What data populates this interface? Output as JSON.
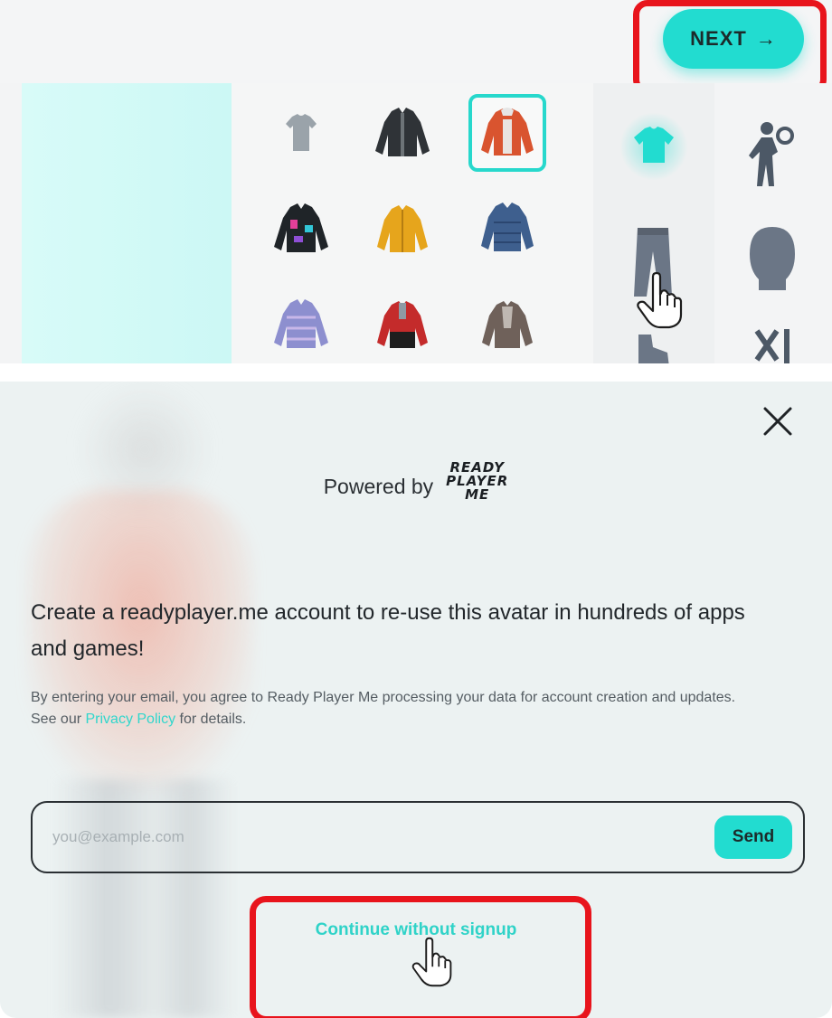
{
  "top_panel": {
    "next_button": {
      "label": "NEXT",
      "icon": "arrow-right-icon"
    },
    "outfit_items": [
      {
        "name": "grey-tshirt",
        "selected": false
      },
      {
        "name": "black-jacket",
        "selected": false
      },
      {
        "name": "red-puffer-jacket",
        "selected": true
      },
      {
        "name": "colorful-black-jacket",
        "selected": false
      },
      {
        "name": "yellow-jacket",
        "selected": false
      },
      {
        "name": "blue-puffer-jacket",
        "selected": false
      },
      {
        "name": "purple-puffer-jacket",
        "selected": false
      },
      {
        "name": "red-black-jacket",
        "selected": false
      },
      {
        "name": "grey-brown-jacket",
        "selected": false
      }
    ],
    "categories": [
      {
        "icon": "shirt-icon",
        "active": true
      },
      {
        "icon": "pants-icon",
        "active": false
      },
      {
        "icon": "shoe-icon",
        "active": false
      },
      {
        "icon": "pose-icon",
        "active": false
      },
      {
        "icon": "head-icon",
        "active": false
      },
      {
        "icon": "scissors-icon",
        "active": false
      }
    ]
  },
  "signup_dialog": {
    "close_icon": "close-icon",
    "powered_by": "Powered by",
    "logo_lines": [
      "READY",
      "PLAYER",
      "ME"
    ],
    "headline": "Create a readyplayer.me account to re-use this avatar in hundreds of apps and games!",
    "disclaimer_line1": "By entering your email, you agree to Ready Player Me processing your data for account creation and updates.",
    "disclaimer_prefix": "See our ",
    "privacy_link": "Privacy Policy",
    "disclaimer_suffix": " for details.",
    "email_placeholder": "you@example.com",
    "send_label": "Send",
    "continue_label": "Continue without signup"
  },
  "colors": {
    "accent": "#22dcd0",
    "highlight": "#e8141c",
    "link": "#31d6cc"
  }
}
